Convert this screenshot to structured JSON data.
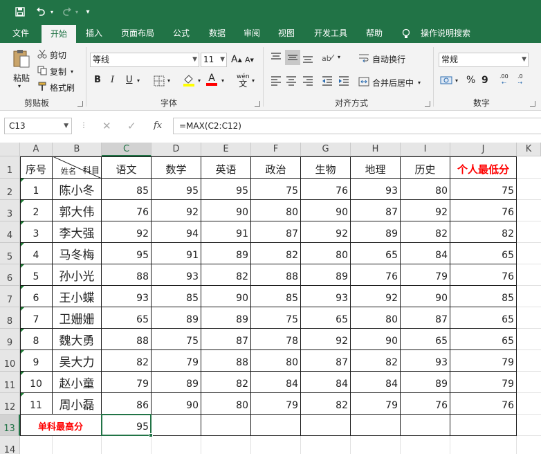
{
  "quick_access": {
    "save_icon": "save-icon",
    "undo_icon": "undo-icon",
    "redo_icon": "redo-icon",
    "customize_icon": "customize-icon"
  },
  "tabs": [
    "文件",
    "开始",
    "插入",
    "页面布局",
    "公式",
    "数据",
    "审阅",
    "视图",
    "开发工具",
    "帮助"
  ],
  "active_tab": "开始",
  "tell_me": "操作说明搜索",
  "ribbon": {
    "clipboard": {
      "label": "剪贴板",
      "paste": "粘贴",
      "cut": "剪切",
      "copy": "复制",
      "format_painter": "格式刷"
    },
    "font": {
      "label": "字体",
      "font_name": "等线",
      "font_size": "11",
      "grow": "A",
      "shrink": "A",
      "bold": "B",
      "italic": "I",
      "underline": "U",
      "font_color": "A",
      "phonetic": "wén"
    },
    "alignment": {
      "label": "对齐方式",
      "wrap_text": "自动换行",
      "merge_center": "合并后居中"
    },
    "number": {
      "label": "数字",
      "format": "常规",
      "percent": "%",
      "comma": "9",
      "inc_decimal": ".00",
      "dec_decimal": ".0"
    }
  },
  "formula_bar": {
    "name_box": "C13",
    "cancel": "✕",
    "enter": "✓",
    "fx": "fx",
    "formula": "=MAX(C2:C12)"
  },
  "sheet": {
    "columns": [
      "A",
      "B",
      "C",
      "D",
      "E",
      "F",
      "G",
      "H",
      "I",
      "J",
      "K"
    ],
    "rows": [
      "1",
      "2",
      "3",
      "4",
      "5",
      "6",
      "7",
      "8",
      "9",
      "10",
      "11",
      "12",
      "13",
      "14"
    ],
    "header_row": {
      "seq": "序号",
      "diag_name": "姓名",
      "diag_subject": "科目",
      "subjects": [
        "语文",
        "数学",
        "英语",
        "政治",
        "生物",
        "地理",
        "历史"
      ],
      "min_label": "个人最低分"
    },
    "students": [
      {
        "seq": "1",
        "name": "陈小冬",
        "scores": [
          "85",
          "95",
          "95",
          "75",
          "76",
          "93",
          "80"
        ],
        "min": "75"
      },
      {
        "seq": "2",
        "name": "郭大伟",
        "scores": [
          "76",
          "92",
          "90",
          "80",
          "90",
          "87",
          "92"
        ],
        "min": "76"
      },
      {
        "seq": "3",
        "name": "李大强",
        "scores": [
          "92",
          "94",
          "91",
          "87",
          "92",
          "89",
          "82"
        ],
        "min": "82"
      },
      {
        "seq": "4",
        "name": "马冬梅",
        "scores": [
          "95",
          "91",
          "89",
          "82",
          "80",
          "65",
          "84"
        ],
        "min": "65"
      },
      {
        "seq": "5",
        "name": "孙小光",
        "scores": [
          "88",
          "93",
          "82",
          "88",
          "89",
          "76",
          "79"
        ],
        "min": "76"
      },
      {
        "seq": "6",
        "name": "王小蝶",
        "scores": [
          "93",
          "85",
          "90",
          "85",
          "93",
          "92",
          "90"
        ],
        "min": "85"
      },
      {
        "seq": "7",
        "name": "卫姗姗",
        "scores": [
          "65",
          "89",
          "89",
          "75",
          "65",
          "80",
          "87"
        ],
        "min": "65"
      },
      {
        "seq": "8",
        "name": "魏大勇",
        "scores": [
          "88",
          "75",
          "87",
          "78",
          "92",
          "90",
          "65"
        ],
        "min": "65"
      },
      {
        "seq": "9",
        "name": "吴大力",
        "scores": [
          "82",
          "79",
          "88",
          "80",
          "87",
          "82",
          "93"
        ],
        "min": "79"
      },
      {
        "seq": "10",
        "name": "赵小童",
        "scores": [
          "79",
          "89",
          "82",
          "84",
          "84",
          "84",
          "89"
        ],
        "min": "79"
      },
      {
        "seq": "11",
        "name": "周小磊",
        "scores": [
          "86",
          "90",
          "80",
          "79",
          "82",
          "79",
          "76"
        ],
        "min": "76"
      }
    ],
    "max_row": {
      "label": "单科最高分",
      "value": "95"
    },
    "selected_cell": "C13"
  },
  "colors": {
    "excel_green": "#217346",
    "red": "#ff0000",
    "error_tri": "#1e7d35"
  }
}
